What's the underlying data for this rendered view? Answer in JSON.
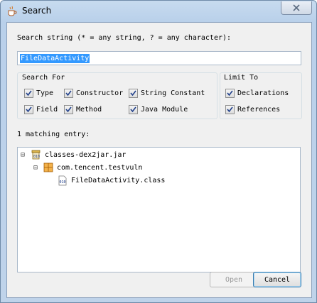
{
  "window": {
    "title": "Search"
  },
  "search": {
    "label": "Search string (* = any string, ? = any character):",
    "value": "FileDataActivity"
  },
  "search_for": {
    "title": "Search For",
    "options": [
      {
        "label": "Type",
        "checked": true
      },
      {
        "label": "Constructor",
        "checked": true
      },
      {
        "label": "String Constant",
        "checked": true
      },
      {
        "label": "Field",
        "checked": true
      },
      {
        "label": "Method",
        "checked": true
      },
      {
        "label": "Java Module",
        "checked": true
      }
    ]
  },
  "limit_to": {
    "title": "Limit To",
    "options": [
      {
        "label": "Declarations",
        "checked": true
      },
      {
        "label": "References",
        "checked": true
      }
    ]
  },
  "results": {
    "label": "1 matching entry:",
    "tree": [
      {
        "label": "classes-dex2jar.jar",
        "icon": "jar-icon",
        "expander": "⊟"
      },
      {
        "label": "com.tencent.testvuln",
        "icon": "package-icon",
        "expander": "⊟"
      },
      {
        "label": "FileDataActivity.class",
        "icon": "class-file-icon",
        "expander": ""
      }
    ]
  },
  "buttons": {
    "open": "Open",
    "cancel": "Cancel"
  },
  "colors": {
    "selection": "#3399ff",
    "accent": "#2a6cb7",
    "jar": "#c8a13a",
    "package": "#d06a00"
  }
}
